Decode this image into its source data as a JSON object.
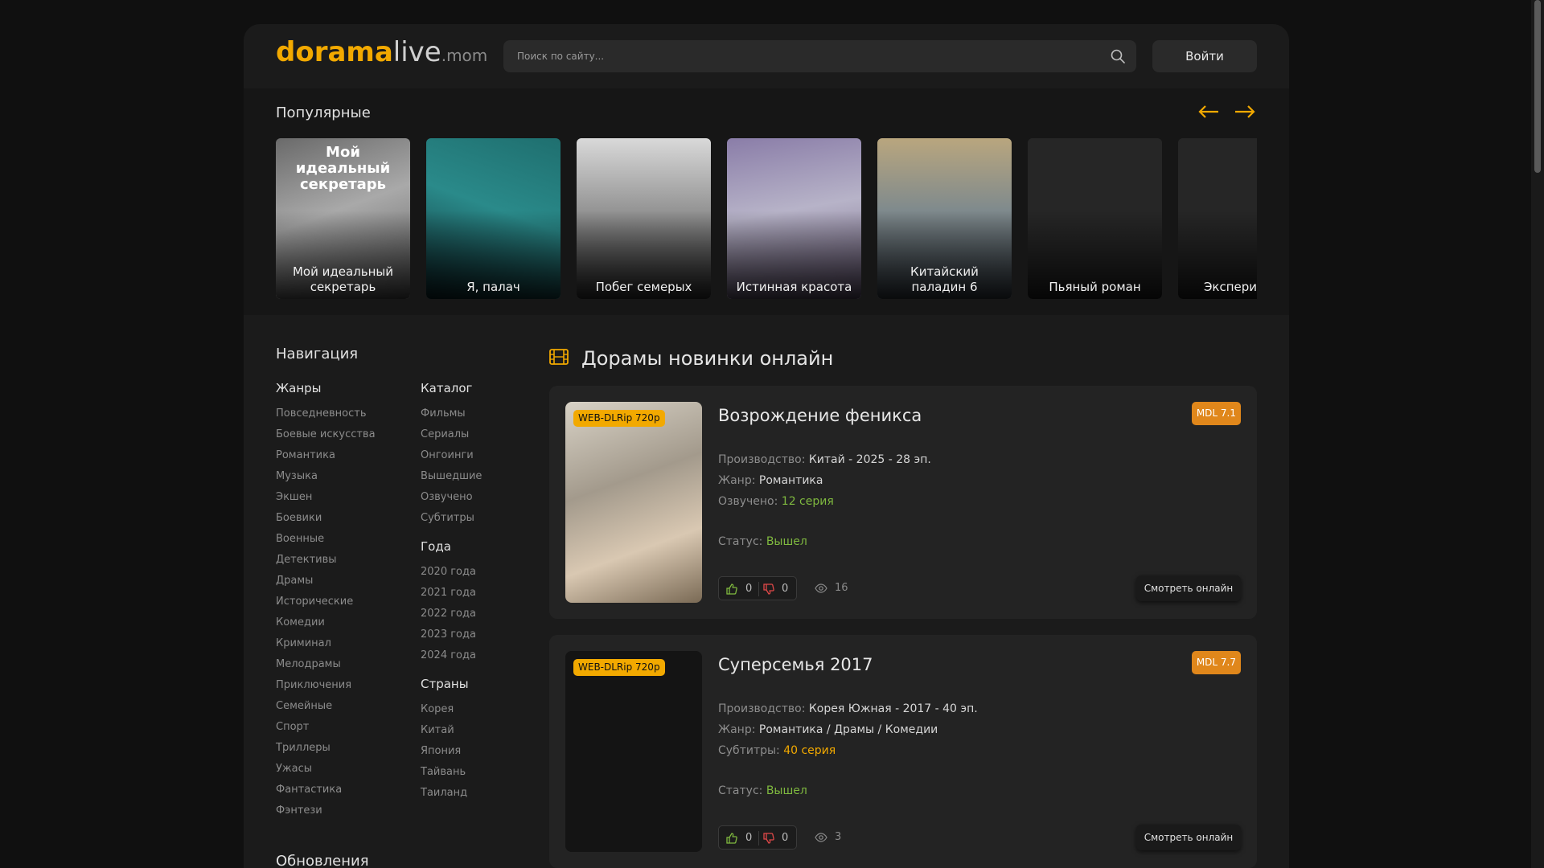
{
  "colors": {
    "accent": "#f2a900",
    "mdl": "#e0871b",
    "status_green": "#7fb93f",
    "bg": "#101010",
    "panel": "#1b1b1b"
  },
  "logo": {
    "part1": "dorama",
    "part2": "live",
    "part3": ".mom"
  },
  "search": {
    "placeholder": "Поиск по сайту..."
  },
  "header": {
    "login_label": "Войти"
  },
  "popular": {
    "title": "Популярные",
    "items": [
      {
        "caption": "Мой идеальный секретарь",
        "overlay_title": "Мой идеальный секретарь"
      },
      {
        "caption": "Я, палач"
      },
      {
        "caption": "Побег семерых"
      },
      {
        "caption": "Истинная красота"
      },
      {
        "caption": "Китайский паладин 6"
      },
      {
        "caption": "Пьяный роман"
      },
      {
        "caption": "Экспери «Ведьм"
      }
    ]
  },
  "sidebar": {
    "title": "Навигация",
    "genres": {
      "heading": "Жанры",
      "items": [
        "Повседневность",
        "Боевые искусства",
        "Романтика",
        "Музыка",
        "Экшен",
        "Боевики",
        "Военные",
        "Детективы",
        "Драмы",
        "Исторические",
        "Комедии",
        "Криминал",
        "Мелодрамы",
        "Приключения",
        "Семейные",
        "Спорт",
        "Триллеры",
        "Ужасы",
        "Фантастика",
        "Фэнтези"
      ]
    },
    "catalog": {
      "heading": "Каталог",
      "items": [
        "Фильмы",
        "Сериалы",
        "Онгоинги",
        "Вышедшие",
        "Озвучено",
        "Субтитры"
      ]
    },
    "years": {
      "heading": "Года",
      "items": [
        "2020 года",
        "2021 года",
        "2022 года",
        "2023 года",
        "2024 года"
      ]
    },
    "countries": {
      "heading": "Страны",
      "items": [
        "Корея",
        "Китай",
        "Япония",
        "Тайвань",
        "Таиланд"
      ]
    },
    "updates_title": "Обновления"
  },
  "main": {
    "section_title": "Дорамы новинки онлайн",
    "cards": [
      {
        "quality": "WEB-DLRip 720p",
        "title": "Возрождение феникса",
        "mdl": "MDL 7.1",
        "production_label": "Производство:",
        "production_value": "Китай - 2025 - 28 эп.",
        "genre_label": "Жанр:",
        "genre_value": "Романтика",
        "voice_label": "Озвучено:",
        "voice_value": "12 серия",
        "status_label": "Статус:",
        "status_value": "Вышел",
        "likes": "0",
        "dislikes": "0",
        "views": "16",
        "watch_label": "Смотреть онлайн"
      },
      {
        "quality": "WEB-DLRip 720p",
        "title": "Суперсемья 2017",
        "mdl": "MDL 7.7",
        "production_label": "Производство:",
        "production_value": "Корея Южная - 2017 - 40 эп.",
        "genre_label": "Жанр:",
        "genre_value": "Романтика / Драмы / Комедии",
        "voice_label": "Субтитры:",
        "voice_value": "40 серия",
        "status_label": "Статус:",
        "status_value": "Вышел",
        "likes": "0",
        "dislikes": "0",
        "views": "3",
        "watch_label": "Смотреть онлайн"
      }
    ]
  }
}
